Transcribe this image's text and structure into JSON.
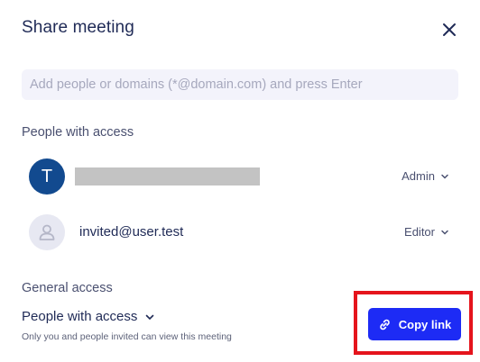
{
  "dialog": {
    "title": "Share meeting",
    "close_icon": "close-icon"
  },
  "invite": {
    "placeholder": "Add people or domains (*@domain.com) and press Enter",
    "value": ""
  },
  "people": {
    "heading": "People with access",
    "members": [
      {
        "avatar_initial": "T",
        "name": "",
        "role": "Admin",
        "avatar_color": "#124a8f"
      },
      {
        "avatar_icon": "user-icon",
        "email": "invited@user.test",
        "role": "Editor"
      }
    ]
  },
  "general": {
    "heading": "General access",
    "selected_option": "People with access",
    "description": "Only you and people invited can view this meeting"
  },
  "copy_link": {
    "label": "Copy link",
    "icon": "link-icon",
    "color": "#1d2bf5",
    "highlight_color": "#e5141c"
  }
}
